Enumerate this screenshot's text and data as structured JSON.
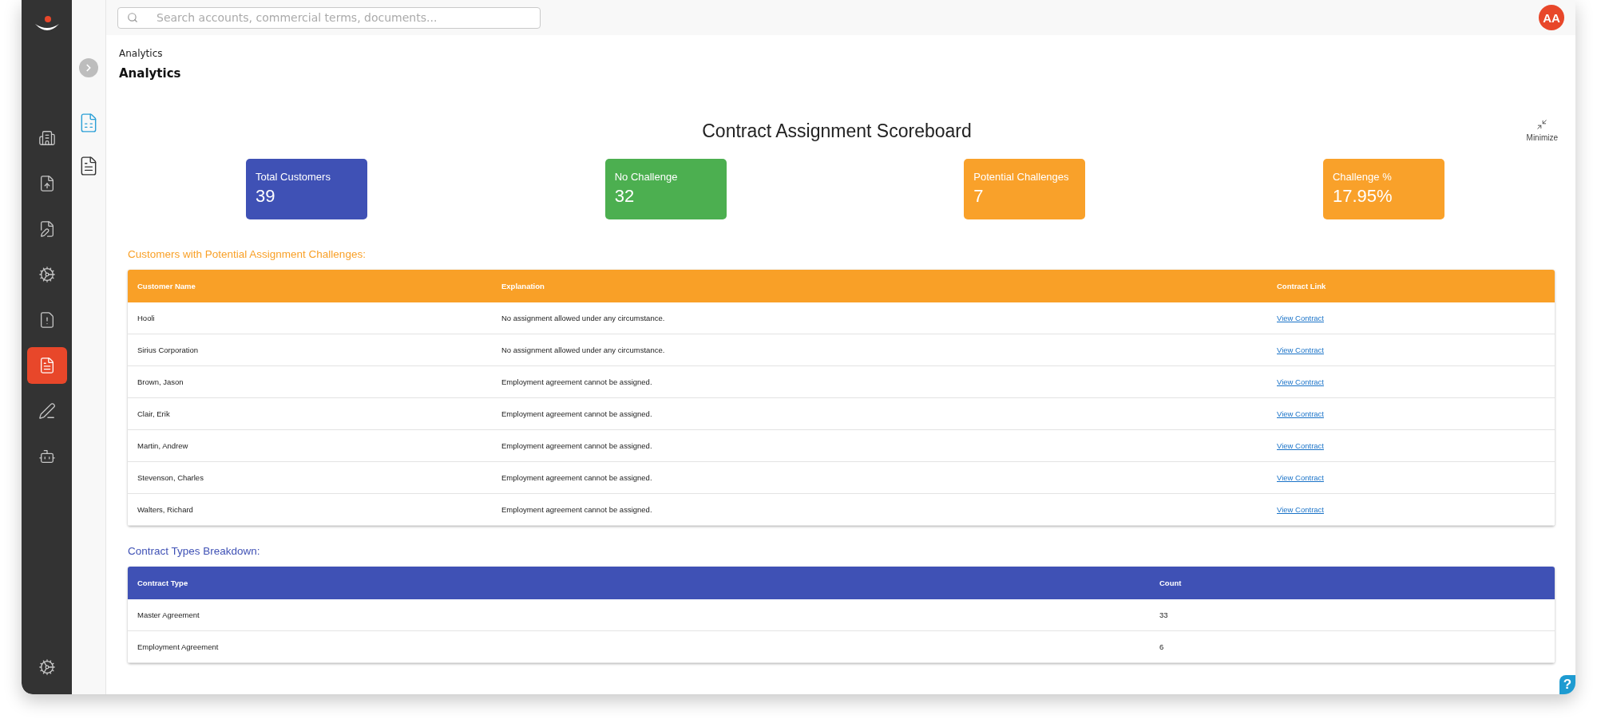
{
  "nav": [
    {
      "kind": "buildings",
      "selected": false
    },
    {
      "kind": "upload",
      "selected": false
    },
    {
      "kind": "edit",
      "selected": false
    },
    {
      "kind": "cog",
      "selected": false
    },
    {
      "kind": "warning",
      "selected": false
    },
    {
      "kind": "report",
      "selected": true
    },
    {
      "kind": "sign",
      "selected": false
    },
    {
      "kind": "bot",
      "selected": false
    }
  ],
  "nav_bottom": {
    "kind": "cog"
  },
  "subnav": [
    {
      "kind": "analytics",
      "selected": true
    },
    {
      "kind": "report",
      "selected": false
    }
  ],
  "search": {
    "placeholder": "Search accounts, commercial terms, documents..."
  },
  "avatar": "AA",
  "breadcrumb": "Analytics",
  "page_title": "Analytics",
  "scoreboard_title": "Contract Assignment Scoreboard",
  "minimize": "Minimize",
  "cards": [
    {
      "label": "Total Customers",
      "value": "39",
      "color": "#3f51b5"
    },
    {
      "label": "No Challenge",
      "value": "32",
      "color": "#4caf50"
    },
    {
      "label": "Potential Challenges",
      "value": "7",
      "color": "#f9a12a"
    },
    {
      "label": "Challenge %",
      "value": "17.95%",
      "color": "#f9a12a"
    }
  ],
  "tables": [
    {
      "title": "Customers with Potential Assignment Challenges:",
      "color": "#f9a027",
      "columns": [
        "Customer Name",
        "Explanation",
        "Contract Link"
      ],
      "rows": [
        [
          "Hooli",
          "No assignment allowed under any circumstance.",
          "View Contract"
        ],
        [
          "Sirius Corporation",
          "No assignment allowed under any circumstance.",
          "View Contract"
        ],
        [
          "Brown, Jason",
          "Employment agreement cannot be assigned.",
          "View Contract"
        ],
        [
          "Clair, Erik",
          "Employment agreement cannot be assigned.",
          "View Contract"
        ],
        [
          "Martin, Andrew",
          "Employment agreement cannot be assigned.",
          "View Contract"
        ],
        [
          "Stevenson, Charles",
          "Employment agreement cannot be assigned.",
          "View Contract"
        ],
        [
          "Walters, Richard",
          "Employment agreement cannot be assigned.",
          "View Contract"
        ]
      ]
    },
    {
      "title": "Contract Types Breakdown:",
      "color": "#3f51b5",
      "columns": [
        "Contract Type",
        "Count"
      ],
      "rows": [
        [
          "Master Agreement",
          "33"
        ],
        [
          "Employment Agreement",
          "6"
        ]
      ]
    }
  ],
  "help": "?"
}
